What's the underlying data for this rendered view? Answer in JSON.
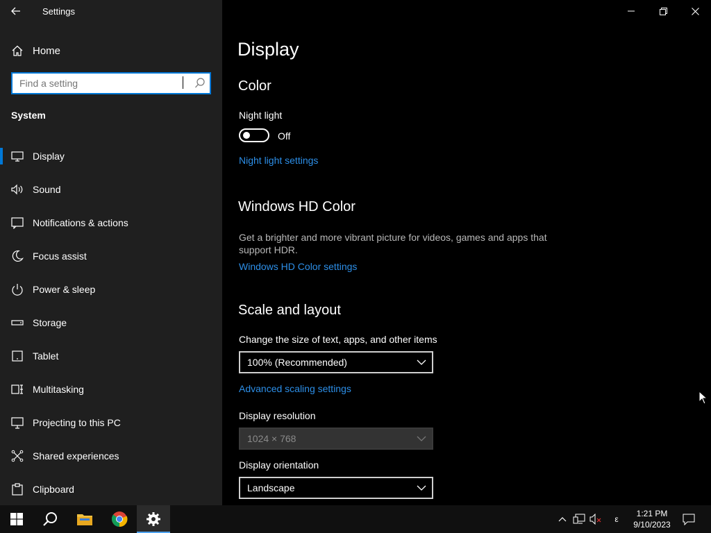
{
  "window": {
    "app_title": "Settings"
  },
  "sidebar": {
    "home_label": "Home",
    "search_placeholder": "Find a setting",
    "section": "System",
    "items": [
      {
        "label": "Display",
        "icon": "monitor-icon",
        "active": true
      },
      {
        "label": "Sound",
        "icon": "speaker-icon"
      },
      {
        "label": "Notifications & actions",
        "icon": "notification-icon"
      },
      {
        "label": "Focus assist",
        "icon": "moon-icon"
      },
      {
        "label": "Power & sleep",
        "icon": "power-icon"
      },
      {
        "label": "Storage",
        "icon": "storage-icon"
      },
      {
        "label": "Tablet",
        "icon": "tablet-icon"
      },
      {
        "label": "Multitasking",
        "icon": "multitasking-icon"
      },
      {
        "label": "Projecting to this PC",
        "icon": "projecting-icon"
      },
      {
        "label": "Shared experiences",
        "icon": "shared-experiences-icon"
      },
      {
        "label": "Clipboard",
        "icon": "clipboard-icon"
      }
    ]
  },
  "main": {
    "title": "Display",
    "color": {
      "heading": "Color",
      "night_light_label": "Night light",
      "night_light_state": "Off",
      "night_light_link": "Night light settings"
    },
    "hdr": {
      "heading": "Windows HD Color",
      "description": "Get a brighter and more vibrant picture for videos, games and apps that support HDR.",
      "link": "Windows HD Color settings"
    },
    "scale": {
      "heading": "Scale and layout",
      "size_label": "Change the size of text, apps, and other items",
      "size_value": "100% (Recommended)",
      "advanced_link": "Advanced scaling settings",
      "resolution_label": "Display resolution",
      "resolution_value": "1024 × 768",
      "orientation_label": "Display orientation",
      "orientation_value": "Landscape"
    }
  },
  "taskbar": {
    "clock_time": "1:21 PM",
    "clock_date": "9/10/2023",
    "ime_indicator": "ε"
  },
  "colors": {
    "accent": "#0078d7",
    "link": "#2d8fe8",
    "sidebar_bg": "#1f1f1f",
    "main_bg": "#000000"
  }
}
